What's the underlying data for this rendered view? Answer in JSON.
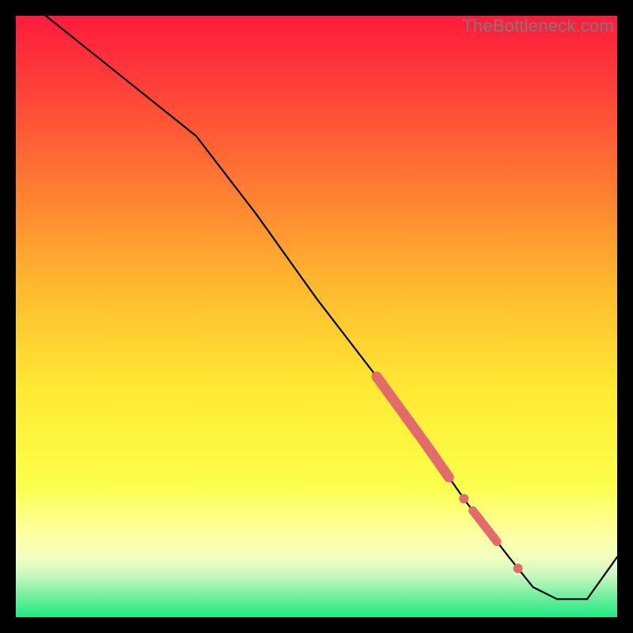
{
  "watermark": "TheBottleneck.com",
  "colors": {
    "gradient_top": "#ff1f3a",
    "gradient_mid_upper": "#ff7a2a",
    "gradient_mid": "#ffe933",
    "gradient_lower_yellow": "#ffff8a",
    "gradient_green_light": "#9df7b0",
    "gradient_green": "#1fe981",
    "line": "#000000",
    "marker": "#e46b6b",
    "watermark": "#7a7a7a",
    "background": "#000000"
  },
  "chart_data": {
    "type": "line",
    "title": "",
    "xlabel": "",
    "ylabel": "",
    "xlim": [
      0,
      100
    ],
    "ylim": [
      0,
      100
    ],
    "note": "Axes are unlabeled; values are estimated from pixel positions on a 0–100 normalized scale. The black curve appears to represent a bottleneck percentage that decreases toward an optimal region (green band at bottom) before rising again.",
    "series": [
      {
        "name": "bottleneck-curve",
        "x": [
          5,
          15,
          30,
          40,
          50,
          60,
          68,
          75,
          82,
          86,
          90,
          95,
          100
        ],
        "y": [
          100,
          92,
          80,
          67,
          53,
          40,
          29,
          19,
          10,
          5,
          3,
          3,
          10
        ]
      }
    ],
    "highlighted_segments": [
      {
        "x_start": 60,
        "x_end": 72,
        "note": "thick salmon highlight on curve"
      },
      {
        "x_start": 74,
        "x_end": 75,
        "note": "small salmon dot"
      },
      {
        "x_start": 76,
        "x_end": 80,
        "note": "medium salmon highlight"
      },
      {
        "x_start": 83,
        "x_end": 84,
        "note": "small salmon dot"
      }
    ],
    "optimal_band": {
      "y_start": 0,
      "y_end": 5,
      "color": "green",
      "note": "green band at bottom indicating optimal / no-bottleneck region"
    }
  }
}
